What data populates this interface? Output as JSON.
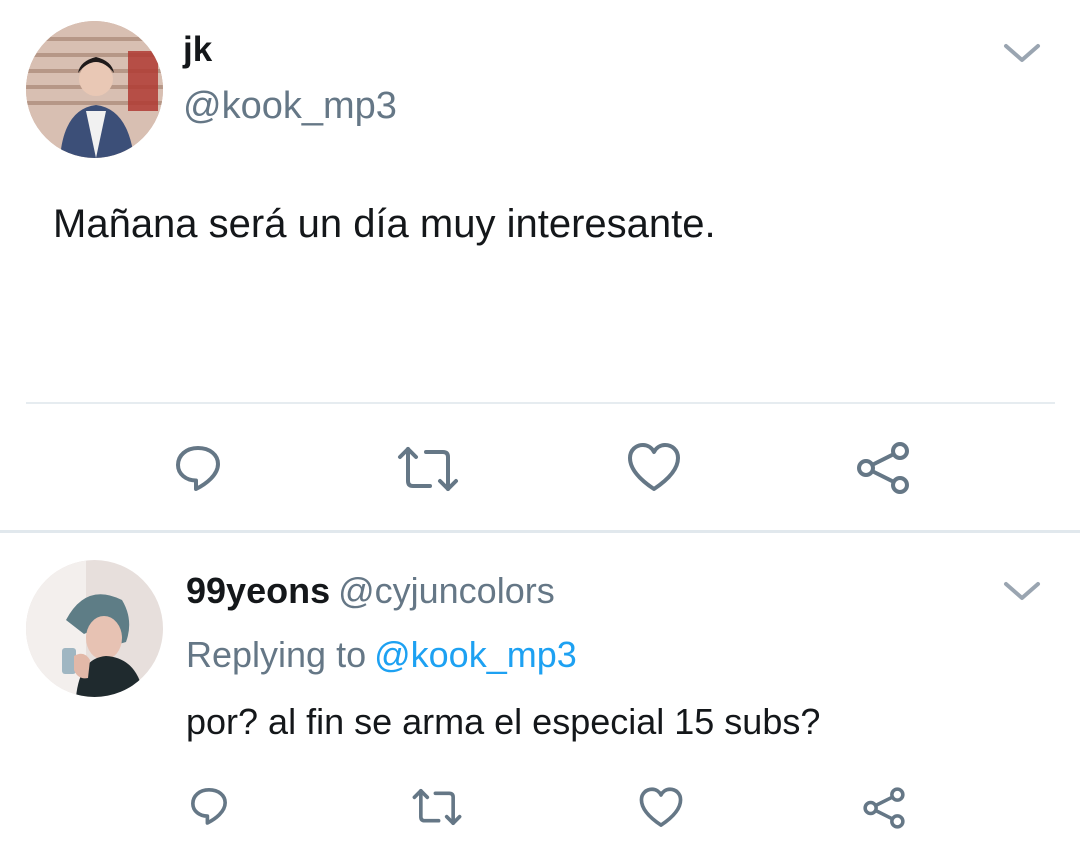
{
  "tweet": {
    "author_name": "jk",
    "author_handle": "@kook_mp3",
    "text": "Mañana será un día muy interesante.",
    "avatar": "avatar-photo-icon",
    "menu_icon": "chevron-down-icon",
    "actions": [
      "reply-icon",
      "retweet-icon",
      "like-icon",
      "share-icon"
    ]
  },
  "reply": {
    "author_name": "99yeons",
    "author_handle": "@cyjuncolors",
    "replying_prefix": "Replying to",
    "replying_handle": "@kook_mp3",
    "text": "por? al fin se arma el especial 15 subs?",
    "avatar": "avatar-photo-icon",
    "menu_icon": "chevron-down-icon",
    "actions": [
      "reply-icon",
      "retweet-icon",
      "like-icon",
      "share-icon"
    ]
  },
  "colors": {
    "text_primary": "#14171a",
    "text_secondary": "#657786",
    "link": "#1da1f2",
    "icon": "#657786",
    "divider": "#e6ecf0"
  }
}
